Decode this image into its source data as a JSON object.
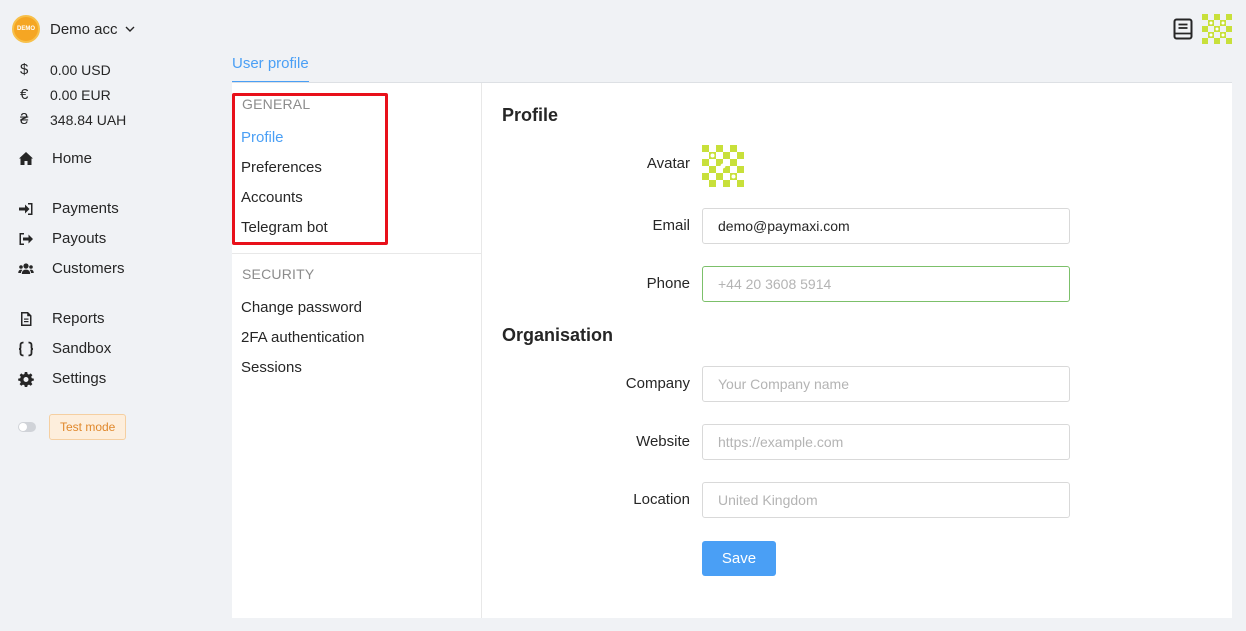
{
  "account": {
    "logo_text": "DEMO",
    "name": "Demo acc"
  },
  "balances": [
    {
      "symbol": "$",
      "amount": "0.00 USD"
    },
    {
      "symbol": "€",
      "amount": "0.00 EUR"
    },
    {
      "symbol": "₴",
      "amount": "348.84 UAH"
    }
  ],
  "nav": {
    "home": "Home",
    "payments": "Payments",
    "payouts": "Payouts",
    "customers": "Customers",
    "reports": "Reports",
    "sandbox": "Sandbox",
    "settings": "Settings"
  },
  "test_mode": {
    "label": "Test mode",
    "enabled": false
  },
  "tab": "User profile",
  "submenu": {
    "general_heading": "GENERAL",
    "profile": "Profile",
    "preferences": "Preferences",
    "accounts": "Accounts",
    "telegram": "Telegram bot",
    "security_heading": "SECURITY",
    "change_password": "Change password",
    "twofa": "2FA authentication",
    "sessions": "Sessions"
  },
  "profile": {
    "title": "Profile",
    "avatar_label": "Avatar",
    "email_label": "Email",
    "email_value": "demo@paymaxi.com",
    "phone_label": "Phone",
    "phone_placeholder": "+44 20 3608 5914"
  },
  "organisation": {
    "title": "Organisation",
    "company_label": "Company",
    "company_placeholder": "Your Company name",
    "website_label": "Website",
    "website_placeholder": "https://example.com",
    "location_label": "Location",
    "location_placeholder": "United Kingdom"
  },
  "save_label": "Save",
  "colors": {
    "accent": "#4a9ff5",
    "highlight": "#e8101a",
    "avatar": "#c8e03a",
    "test_badge": "#e0882c"
  },
  "icons": [
    "chevron-down-icon",
    "home-icon",
    "payments-icon",
    "payouts-icon",
    "customers-icon",
    "reports-icon",
    "sandbox-icon",
    "settings-icon",
    "book-icon",
    "toggle-icon"
  ]
}
